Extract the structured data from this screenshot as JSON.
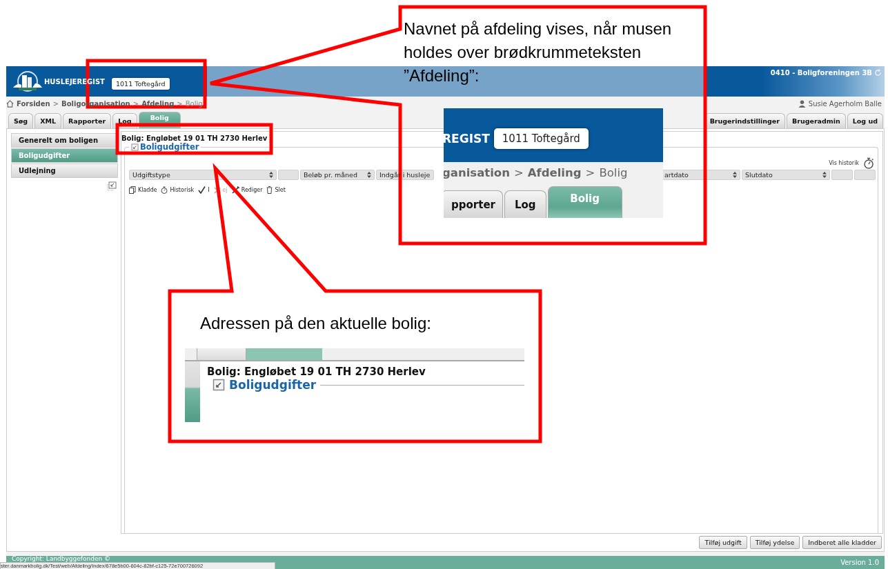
{
  "header": {
    "app_name": "HUSLEJEREGIST",
    "organisation": "0410 - Boligforeningen 3B",
    "tooltip": "1011 Toftegård"
  },
  "breadcrumb": [
    {
      "label": "Forsiden",
      "kind": "link"
    },
    {
      "label": ">",
      "kind": "separator"
    },
    {
      "label": "Boligorganisation",
      "kind": "link"
    },
    {
      "label": ">",
      "kind": "separator"
    },
    {
      "label": "Afdeling",
      "kind": "link"
    },
    {
      "label": ">",
      "kind": "separator"
    },
    {
      "label": "Bolig",
      "kind": "current"
    }
  ],
  "user": "Susie Agerholm Balle",
  "tabs_left": [
    {
      "label": "Søg",
      "selected": false
    },
    {
      "label": "XML",
      "selected": false
    },
    {
      "label": "Rapporter",
      "selected": false
    },
    {
      "label": "Log",
      "selected": false
    },
    {
      "label": "Bolig",
      "selected": true
    }
  ],
  "tabs_right": [
    {
      "label": "Brugerindstillinger",
      "selected": false
    },
    {
      "label": "Brugeradmin",
      "selected": false
    },
    {
      "label": "Log ud",
      "selected": false
    }
  ],
  "sidebar": [
    {
      "label": "Generelt om boligen",
      "selected": false
    },
    {
      "label": "Boligudgifter",
      "selected": true
    },
    {
      "label": "Udlejning",
      "selected": false
    }
  ],
  "main": {
    "address": "Bolig: Engløbet 19 01 TH 2730 Herlev",
    "section_title": "Boligudgifter",
    "history_link": "Vis historik",
    "columns": [
      {
        "label": "Udgiftstype",
        "sortable": true
      },
      {
        "sortable": false
      },
      {
        "label": "Beløb pr. måned",
        "sortable": true
      },
      {
        "label": "Indgår i husleje",
        "sortable": false
      },
      {
        "label": "artdato",
        "sortable": true
      },
      {
        "label": "Slutdato",
        "sortable": true
      },
      {
        "sortable": false
      },
      {
        "sortable": false
      }
    ],
    "toolbar": [
      {
        "label": "Kladde",
        "kind": "copy",
        "disabled": false
      },
      {
        "label": "Historisk",
        "kind": "timer",
        "disabled": false
      },
      {
        "label": "I",
        "kind": "check",
        "disabled": false
      },
      {
        "label": "ej",
        "kind": "cross",
        "disabled": true
      },
      {
        "label": "Rediger",
        "kind": "tools",
        "disabled": false
      },
      {
        "label": "Slet",
        "kind": "trash",
        "disabled": false
      }
    ]
  },
  "buttons": [
    "Tilføj udgift",
    "Tilføj ydelse",
    "Indberet alle kladder"
  ],
  "footer": {
    "copyright": "Copyright: Landbyggefonden ©",
    "version": "Version 1.0"
  },
  "status_url": "ster.danmarkbolig.dk/Test/web/Afdeling/Index/678e5b00-604c-82bf-c125-72e700726092",
  "callouts": [
    {
      "text": "Navnet på afdeling vises, når musen holdes over brødkrummeteksten ”Afdeling”:",
      "inset": {
        "brand_fragment": "REGIST",
        "tooltip": "1011 Toftegård",
        "breadcrumb": [
          {
            "label": "ganisation",
            "kind": "link"
          },
          {
            "label": ">",
            "kind": "separator"
          },
          {
            "label": "Afdeling",
            "kind": "link"
          },
          {
            "label": ">",
            "kind": "separator"
          },
          {
            "label": "Bolig",
            "kind": "current"
          }
        ],
        "tabs": [
          {
            "label": "pporter",
            "selected": false
          },
          {
            "label": "Log",
            "selected": false
          },
          {
            "label": "Bolig",
            "selected": true
          }
        ]
      }
    },
    {
      "text": "Adressen på den aktuelle bolig:",
      "inset": {
        "address": "Bolig: Engløbet 19 01 TH 2730 Herlev",
        "section_title": "Boligudgifter"
      }
    }
  ]
}
